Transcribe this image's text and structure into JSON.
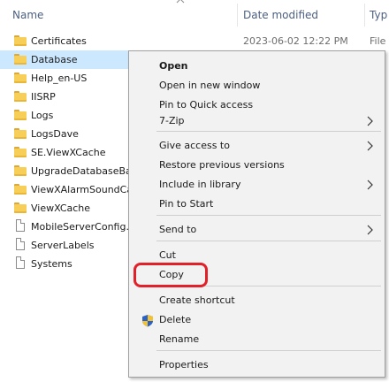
{
  "columns": {
    "name": "Name",
    "date_modified": "Date modified",
    "type": "Typ"
  },
  "files": [
    {
      "name": "Certificates",
      "kind": "folder",
      "selected": false
    },
    {
      "name": "Database",
      "kind": "folder",
      "selected": true
    },
    {
      "name": "Help_en-US",
      "kind": "folder",
      "selected": false
    },
    {
      "name": "IISRP",
      "kind": "folder",
      "selected": false
    },
    {
      "name": "Logs",
      "kind": "folder",
      "selected": false
    },
    {
      "name": "LogsDave",
      "kind": "folder",
      "selected": false
    },
    {
      "name": "SE.ViewXCache",
      "kind": "folder",
      "selected": false
    },
    {
      "name": "UpgradeDatabaseBac",
      "kind": "folder",
      "selected": false
    },
    {
      "name": "ViewXAlarmSoundCa",
      "kind": "folder",
      "selected": false
    },
    {
      "name": "ViewXCache",
      "kind": "folder",
      "selected": false
    },
    {
      "name": "MobileServerConfig.",
      "kind": "file",
      "selected": false
    },
    {
      "name": "ServerLabels",
      "kind": "file",
      "selected": false
    },
    {
      "name": "Systems",
      "kind": "file",
      "selected": false
    }
  ],
  "first_row_date": "2023-06-02 12:22 PM",
  "first_row_type": "File",
  "context_menu": {
    "items": [
      {
        "label": "Open",
        "bold": true,
        "submenu": false
      },
      {
        "label": "Open in new window",
        "bold": false,
        "submenu": false
      },
      {
        "label": "Pin to Quick access",
        "bold": false,
        "submenu": false
      },
      {
        "label": "7-Zip",
        "bold": false,
        "submenu": true
      },
      {
        "label": "Give access to",
        "bold": false,
        "submenu": true
      },
      {
        "label": "Restore previous versions",
        "bold": false,
        "submenu": false
      },
      {
        "label": "Include in library",
        "bold": false,
        "submenu": true
      },
      {
        "label": "Pin to Start",
        "bold": false,
        "submenu": false
      },
      {
        "label": "Send to",
        "bold": false,
        "submenu": true
      },
      {
        "label": "Cut",
        "bold": false,
        "submenu": false
      },
      {
        "label": "Copy",
        "bold": false,
        "submenu": false,
        "highlighted": true
      },
      {
        "label": "Create shortcut",
        "bold": false,
        "submenu": false
      },
      {
        "label": "Delete",
        "bold": false,
        "submenu": false,
        "icon": "uac-shield-icon"
      },
      {
        "label": "Rename",
        "bold": false,
        "submenu": false
      },
      {
        "label": "Properties",
        "bold": false,
        "submenu": false
      }
    ]
  },
  "colors": {
    "selection": "#cce8ff",
    "highlight_outline": "#e2202a",
    "folder": "#f7cf58"
  }
}
